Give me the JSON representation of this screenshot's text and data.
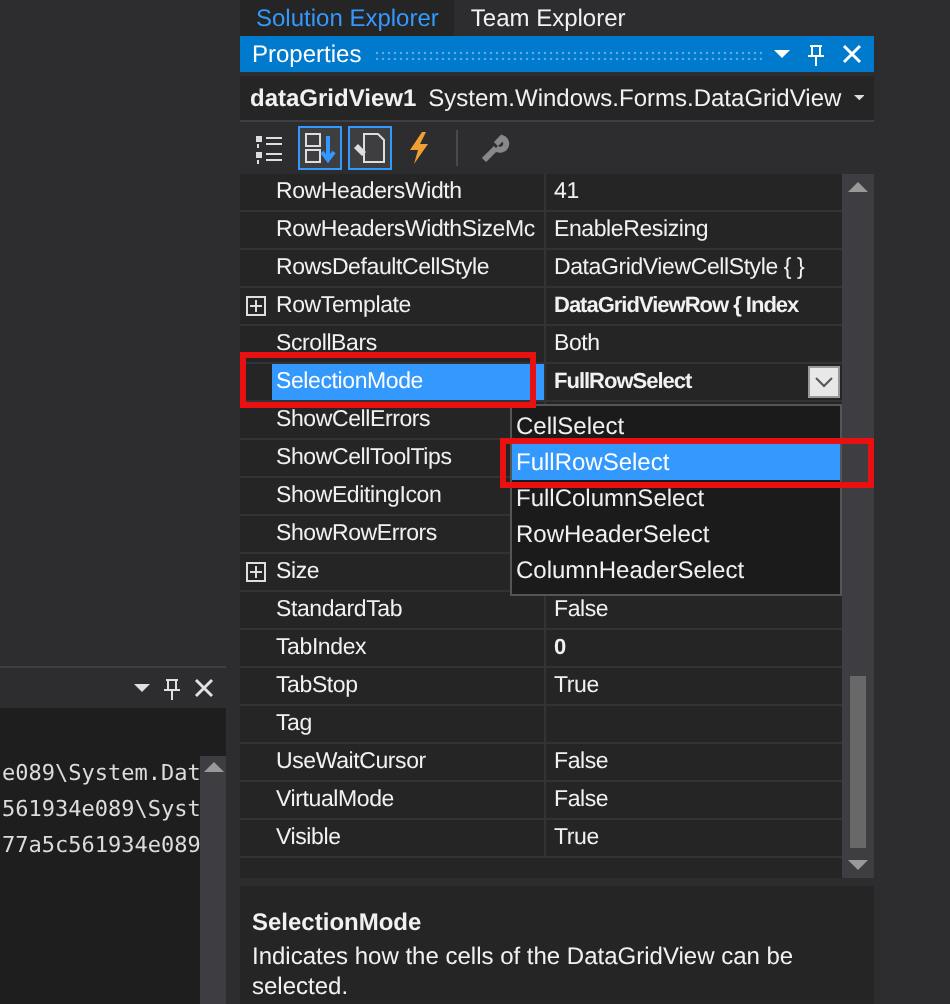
{
  "tabs": [
    {
      "label": "Solution Explorer",
      "selected": true
    },
    {
      "label": "Team Explorer",
      "selected": false
    }
  ],
  "output": {
    "lines": [
      "e089\\System.Dat",
      "561934e089\\Syst",
      "77a5c561934e089"
    ]
  },
  "properties": {
    "title": "Properties",
    "object_name": "dataGridView1",
    "object_type": "System.Windows.Forms.DataGridView",
    "toolbar": [
      {
        "kind": "categorized",
        "selected": false
      },
      {
        "kind": "alphabetical",
        "selected": true
      },
      {
        "kind": "properties",
        "selected": true
      },
      {
        "kind": "events",
        "selected": false
      },
      {
        "kind": "property-pages",
        "selected": false
      }
    ],
    "rows": [
      {
        "name": "RowHeadersWidth",
        "value": "41",
        "bold": false,
        "expandable": false,
        "selected": false,
        "highlighted": false
      },
      {
        "name": "RowHeadersWidthSizeMc",
        "value": "EnableResizing",
        "bold": false,
        "expandable": false,
        "selected": false,
        "highlighted": false
      },
      {
        "name": "RowsDefaultCellStyle",
        "value": "DataGridViewCellStyle { }",
        "bold": false,
        "expandable": false,
        "selected": false,
        "highlighted": false
      },
      {
        "name": "RowTemplate",
        "value": "DataGridViewRow { Index",
        "bold": true,
        "expandable": true,
        "selected": false,
        "highlighted": false
      },
      {
        "name": "ScrollBars",
        "value": "Both",
        "bold": false,
        "expandable": false,
        "selected": false,
        "highlighted": false
      },
      {
        "name": "SelectionMode",
        "value": "FullRowSelect",
        "bold": true,
        "expandable": false,
        "selected": true,
        "highlighted": true
      },
      {
        "name": "ShowCellErrors",
        "expandable": false,
        "selected": false,
        "highlighted": false
      },
      {
        "name": "ShowCellToolTips",
        "expandable": false,
        "selected": false,
        "highlighted": false
      },
      {
        "name": "ShowEditingIcon",
        "expandable": false,
        "selected": false,
        "highlighted": false
      },
      {
        "name": "ShowRowErrors",
        "expandable": false,
        "selected": false,
        "highlighted": false
      },
      {
        "name": "Size",
        "expandable": true,
        "selected": false,
        "highlighted": false
      },
      {
        "name": "StandardTab",
        "value": "False",
        "bold": false,
        "expandable": false,
        "selected": false,
        "highlighted": false
      },
      {
        "name": "TabIndex",
        "value": "0",
        "bold": true,
        "expandable": false,
        "selected": false,
        "highlighted": false
      },
      {
        "name": "TabStop",
        "value": "True",
        "bold": false,
        "expandable": false,
        "selected": false,
        "highlighted": false
      },
      {
        "name": "Tag",
        "expandable": false,
        "selected": false,
        "highlighted": false
      },
      {
        "name": "UseWaitCursor",
        "value": "False",
        "bold": false,
        "expandable": false,
        "selected": false,
        "highlighted": false
      },
      {
        "name": "VirtualMode",
        "value": "False",
        "bold": false,
        "expandable": false,
        "selected": false,
        "highlighted": false
      },
      {
        "name": "Visible",
        "value": "True",
        "bold": false,
        "expandable": false,
        "selected": false,
        "highlighted": false
      }
    ],
    "dropdown": {
      "options": [
        {
          "label": "CellSelect",
          "selected": false,
          "highlighted": false
        },
        {
          "label": "FullRowSelect",
          "selected": true,
          "highlighted": true
        },
        {
          "label": "FullColumnSelect",
          "selected": false,
          "highlighted": false
        },
        {
          "label": "RowHeaderSelect",
          "selected": false,
          "highlighted": false
        },
        {
          "label": "ColumnHeaderSelect",
          "selected": false,
          "highlighted": false
        }
      ]
    },
    "description": {
      "title": "SelectionMode",
      "text": "Indicates how the cells of the DataGridView can be selected."
    }
  }
}
